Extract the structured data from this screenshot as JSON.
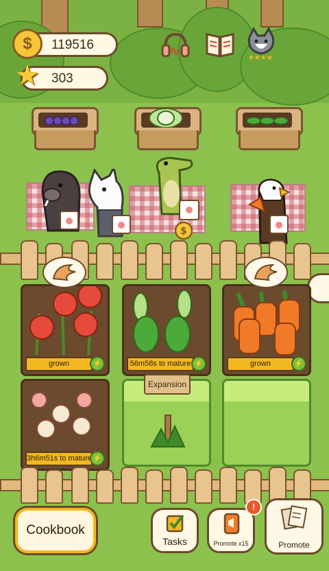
{
  "resources": {
    "coins": "119516",
    "stars": "303",
    "coin_symbol": "$"
  },
  "top_icons": [
    "headphones-icon",
    "recipe-book-icon",
    "cat-avatar-icon"
  ],
  "baskets": [
    {
      "contents": "grapes"
    },
    {
      "contents": "cabbage"
    },
    {
      "contents": "peas"
    }
  ],
  "customers": [
    "boar",
    "wolf",
    "crocodile",
    "eagle"
  ],
  "plots": [
    {
      "crop": "tomato",
      "status": "grown",
      "has_bubble": true
    },
    {
      "crop": "cabbage",
      "status": "56m58s to mature",
      "has_bubble": false
    },
    {
      "crop": "carrot",
      "status": "grown",
      "has_bubble": true
    },
    {
      "crop": "onion",
      "status": "3h6m51s to mature",
      "has_bubble": false
    },
    {
      "crop": "expansion",
      "sign": "Expansion"
    },
    {
      "crop": "empty"
    }
  ],
  "buttons": {
    "cookbook": "Cookbook",
    "tasks": "Tasks",
    "promote_x15": "Promote x15",
    "promote": "Promote",
    "alert": "!"
  },
  "colors": {
    "ground": "#8cc14e",
    "label": "#f2b820",
    "outline": "#6b4a2a"
  }
}
